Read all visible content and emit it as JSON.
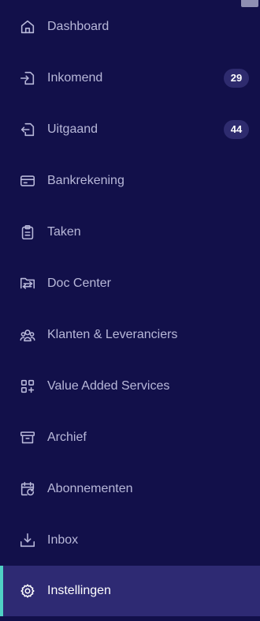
{
  "theme": {
    "background": "#12104a",
    "active_background": "#2e2a73",
    "active_indicator": "#4fd1c5",
    "badge_background": "#2e2b6e",
    "label_color": "#b8b8d9"
  },
  "sidebar": {
    "items": [
      {
        "label": "Dashboard",
        "icon": "home-icon"
      },
      {
        "label": "Inkomend",
        "icon": "inbox-in-icon",
        "badge": "29"
      },
      {
        "label": "Uitgaand",
        "icon": "outbox-icon",
        "badge": "44"
      },
      {
        "label": "Bankrekening",
        "icon": "credit-card-icon"
      },
      {
        "label": "Taken",
        "icon": "clipboard-icon"
      },
      {
        "label": "Doc Center",
        "icon": "folder-transfer-icon"
      },
      {
        "label": "Klanten & Leveranciers",
        "icon": "users-icon"
      },
      {
        "label": "Value Added Services",
        "icon": "apps-plus-icon"
      },
      {
        "label": "Archief",
        "icon": "archive-box-icon"
      },
      {
        "label": "Abonnementen",
        "icon": "calendar-refresh-icon"
      },
      {
        "label": "Inbox",
        "icon": "download-tray-icon"
      },
      {
        "label": "Instellingen",
        "icon": "gear-icon",
        "active": true
      }
    ]
  }
}
